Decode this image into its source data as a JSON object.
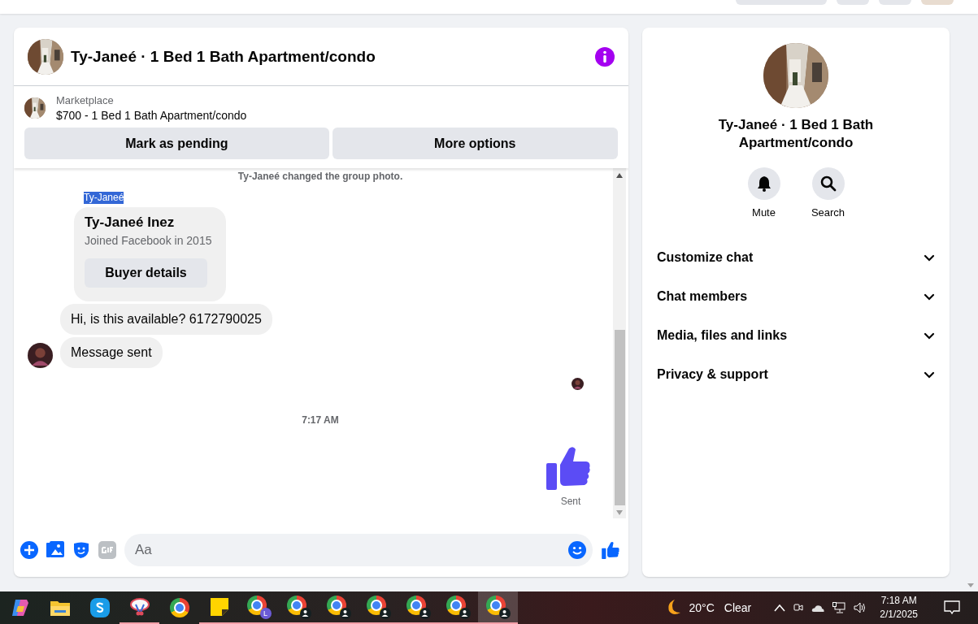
{
  "header": {
    "title": "Ty-Janeé · 1 Bed 1 Bath Apartment/condo"
  },
  "listing": {
    "source": "Marketplace",
    "title": "$700 - 1 Bed 1 Bath Apartment/condo",
    "buttons": [
      "Mark as pending",
      "More options"
    ]
  },
  "messages": [
    {
      "kind": "system",
      "text": "Ty-Janeé changed the group photo."
    },
    {
      "kind": "sender",
      "text": "Ty-Janeé",
      "text_selected": true
    },
    {
      "kind": "profile",
      "name": "Ty-Janeé Inez",
      "subtitle": "Joined Facebook in 2015",
      "button": "Buyer details"
    },
    {
      "kind": "bubble",
      "text": "Hi, is this available? 6172790025",
      "avatar": false
    },
    {
      "kind": "bubble",
      "text": "Message sent",
      "avatar": true
    },
    {
      "kind": "seen"
    },
    {
      "kind": "time",
      "text": "7:17 AM"
    },
    {
      "kind": "like",
      "status": "Sent"
    }
  ],
  "composer": {
    "placeholder": "Aa"
  },
  "details": {
    "title": "Ty-Janeé · 1 Bed 1 Bath Apartment/condo",
    "actions": [
      {
        "kind": "mute",
        "label": "Mute"
      },
      {
        "kind": "search",
        "label": "Search"
      }
    ],
    "sections": [
      {
        "label": "Customize chat",
        "expanded": false
      },
      {
        "label": "Chat members",
        "expanded": false
      },
      {
        "label": "Media, files and links",
        "expanded": false
      },
      {
        "label": "Privacy & support",
        "expanded": false
      }
    ]
  },
  "taskbar": {
    "apps": [
      {
        "kind": "copilot",
        "running": false,
        "active": false
      },
      {
        "kind": "explorer",
        "running": false,
        "active": false
      },
      {
        "kind": "skype",
        "running": false,
        "active": false
      },
      {
        "kind": "snip",
        "running": true,
        "active": false
      },
      {
        "kind": "chrome",
        "running": false,
        "active": false
      },
      {
        "kind": "sticky",
        "running": true,
        "active": false
      },
      {
        "kind": "chrome-profile",
        "running": true,
        "active": false
      },
      {
        "kind": "chrome-person",
        "running": true,
        "active": false
      },
      {
        "kind": "chrome-person",
        "running": true,
        "active": false
      },
      {
        "kind": "chrome-person",
        "running": true,
        "active": false
      },
      {
        "kind": "chrome-person",
        "running": true,
        "active": false
      },
      {
        "kind": "chrome-person",
        "running": true,
        "active": false
      },
      {
        "kind": "chrome-person",
        "running": true,
        "active": true
      }
    ],
    "profile_letter": "L",
    "temperature": "20°C",
    "weather": "Clear",
    "time": "7:18 AM",
    "date": "2/1/2025"
  }
}
